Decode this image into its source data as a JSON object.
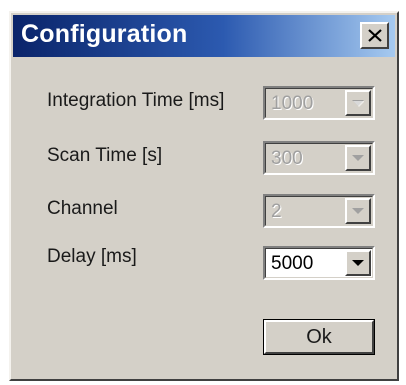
{
  "window": {
    "title": "Configuration"
  },
  "fields": [
    {
      "label": "Integration Time [ms]",
      "value": "1000",
      "enabled": false
    },
    {
      "label": "Scan Time [s]",
      "value": "300",
      "enabled": false
    },
    {
      "label": "Channel",
      "value": "2",
      "enabled": false
    },
    {
      "label": "Delay [ms]",
      "value": "5000",
      "enabled": true
    }
  ],
  "buttons": {
    "ok_label": "Ok"
  },
  "icons": {
    "close": "close-icon",
    "dropdown": "chevron-down-icon"
  },
  "colors": {
    "titlebar_start": "#0a246a",
    "titlebar_end": "#a6caf0",
    "face": "#d4d0c8",
    "disabled_text": "#a0a0a0"
  }
}
